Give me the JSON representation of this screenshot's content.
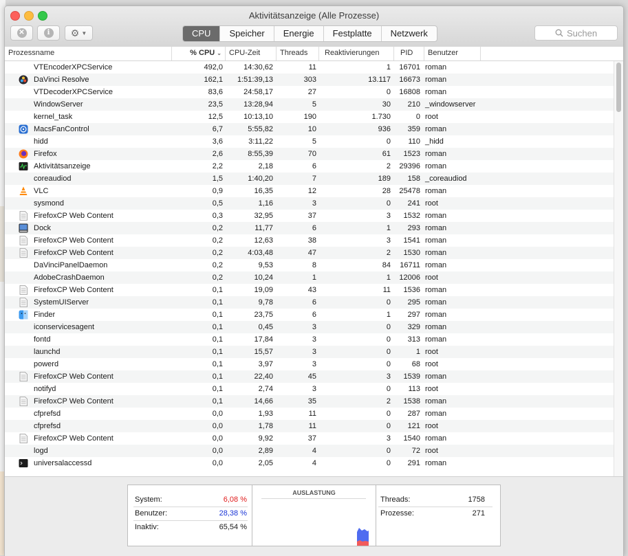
{
  "window": {
    "title": "Aktivitätsanzeige (Alle Prozesse)"
  },
  "toolbar": {
    "close_process_icon": "x-circle-icon",
    "info_icon": "info-icon",
    "gear_icon": "gear-icon",
    "tabs": [
      {
        "label": "CPU",
        "active": true
      },
      {
        "label": "Speicher",
        "active": false
      },
      {
        "label": "Energie",
        "active": false
      },
      {
        "label": "Festplatte",
        "active": false
      },
      {
        "label": "Netzwerk",
        "active": false
      }
    ],
    "search_placeholder": "Suchen"
  },
  "table": {
    "columns": [
      "Prozessname",
      "% CPU",
      "CPU-Zeit",
      "Threads",
      "Reaktivierungen",
      "PID",
      "Benutzer"
    ],
    "rows": [
      [
        "VTEncoderXPCService",
        "492,0",
        "14:30,62",
        "11",
        "1",
        "16701",
        "roman",
        ""
      ],
      [
        "DaVinci Resolve",
        "162,1",
        "1:51:39,13",
        "303",
        "13.117",
        "16673",
        "roman",
        "davinci"
      ],
      [
        "VTDecoderXPCService",
        "83,6",
        "24:58,17",
        "27",
        "0",
        "16808",
        "roman",
        ""
      ],
      [
        "WindowServer",
        "23,5",
        "13:28,94",
        "5",
        "30",
        "210",
        "_windowserver",
        ""
      ],
      [
        "kernel_task",
        "12,5",
        "10:13,10",
        "190",
        "1.730",
        "0",
        "root",
        ""
      ],
      [
        "MacsFanControl",
        "6,7",
        "5:55,82",
        "10",
        "936",
        "359",
        "roman",
        "fan"
      ],
      [
        "hidd",
        "3,6",
        "3:11,22",
        "5",
        "0",
        "110",
        "_hidd",
        ""
      ],
      [
        "Firefox",
        "2,6",
        "8:55,39",
        "70",
        "61",
        "1523",
        "roman",
        "firefox"
      ],
      [
        "Aktivitätsanzeige",
        "2,2",
        "2,18",
        "6",
        "2",
        "29396",
        "roman",
        "monitor"
      ],
      [
        "coreaudiod",
        "1,5",
        "1:40,20",
        "7",
        "189",
        "158",
        "_coreaudiod",
        ""
      ],
      [
        "VLC",
        "0,9",
        "16,35",
        "12",
        "28",
        "25478",
        "roman",
        "vlc"
      ],
      [
        "sysmond",
        "0,5",
        "1,16",
        "3",
        "0",
        "241",
        "root",
        ""
      ],
      [
        "FirefoxCP Web Content",
        "0,3",
        "32,95",
        "37",
        "3",
        "1532",
        "roman",
        "doc"
      ],
      [
        "Dock",
        "0,2",
        "11,77",
        "6",
        "1",
        "293",
        "roman",
        "dock"
      ],
      [
        "FirefoxCP Web Content",
        "0,2",
        "12,63",
        "38",
        "3",
        "1541",
        "roman",
        "doc"
      ],
      [
        "FirefoxCP Web Content",
        "0,2",
        "4:03,48",
        "47",
        "2",
        "1530",
        "roman",
        "doc"
      ],
      [
        "DaVinciPanelDaemon",
        "0,2",
        "9,53",
        "8",
        "84",
        "16711",
        "roman",
        ""
      ],
      [
        "AdobeCrashDaemon",
        "0,2",
        "10,24",
        "1",
        "1",
        "12006",
        "root",
        ""
      ],
      [
        "FirefoxCP Web Content",
        "0,1",
        "19,09",
        "43",
        "11",
        "1536",
        "roman",
        "doc"
      ],
      [
        "SystemUIServer",
        "0,1",
        "9,78",
        "6",
        "0",
        "295",
        "roman",
        "doc"
      ],
      [
        "Finder",
        "0,1",
        "23,75",
        "6",
        "1",
        "297",
        "roman",
        "finder"
      ],
      [
        "iconservicesagent",
        "0,1",
        "0,45",
        "3",
        "0",
        "329",
        "roman",
        ""
      ],
      [
        "fontd",
        "0,1",
        "17,84",
        "3",
        "0",
        "313",
        "roman",
        ""
      ],
      [
        "launchd",
        "0,1",
        "15,57",
        "3",
        "0",
        "1",
        "root",
        ""
      ],
      [
        "powerd",
        "0,1",
        "3,97",
        "3",
        "0",
        "68",
        "root",
        ""
      ],
      [
        "FirefoxCP Web Content",
        "0,1",
        "22,40",
        "45",
        "3",
        "1539",
        "roman",
        "doc"
      ],
      [
        "notifyd",
        "0,1",
        "2,74",
        "3",
        "0",
        "113",
        "root",
        ""
      ],
      [
        "FirefoxCP Web Content",
        "0,1",
        "14,66",
        "35",
        "2",
        "1538",
        "roman",
        "doc"
      ],
      [
        "cfprefsd",
        "0,0",
        "1,93",
        "11",
        "0",
        "287",
        "roman",
        ""
      ],
      [
        "cfprefsd",
        "0,0",
        "1,78",
        "11",
        "0",
        "121",
        "root",
        ""
      ],
      [
        "FirefoxCP Web Content",
        "0,0",
        "9,92",
        "37",
        "3",
        "1540",
        "roman",
        "doc"
      ],
      [
        "logd",
        "0,0",
        "2,89",
        "4",
        "0",
        "72",
        "root",
        ""
      ],
      [
        "universalaccessd",
        "0,0",
        "2,05",
        "4",
        "0",
        "291",
        "roman",
        "terminal"
      ]
    ]
  },
  "stats": {
    "system_label": "System:",
    "system_value": "6,08 %",
    "user_label": "Benutzer:",
    "user_value": "28,38 %",
    "idle_label": "Inaktiv:",
    "idle_value": "65,54 %",
    "graph_title": "AUSLASTUNG",
    "threads_label": "Threads:",
    "threads_value": "1758",
    "processes_label": "Prozesse:",
    "processes_value": "271"
  },
  "colors": {
    "system": "#e01b1b",
    "user": "#1a35d6",
    "tab_active": "#6b6b6b"
  }
}
